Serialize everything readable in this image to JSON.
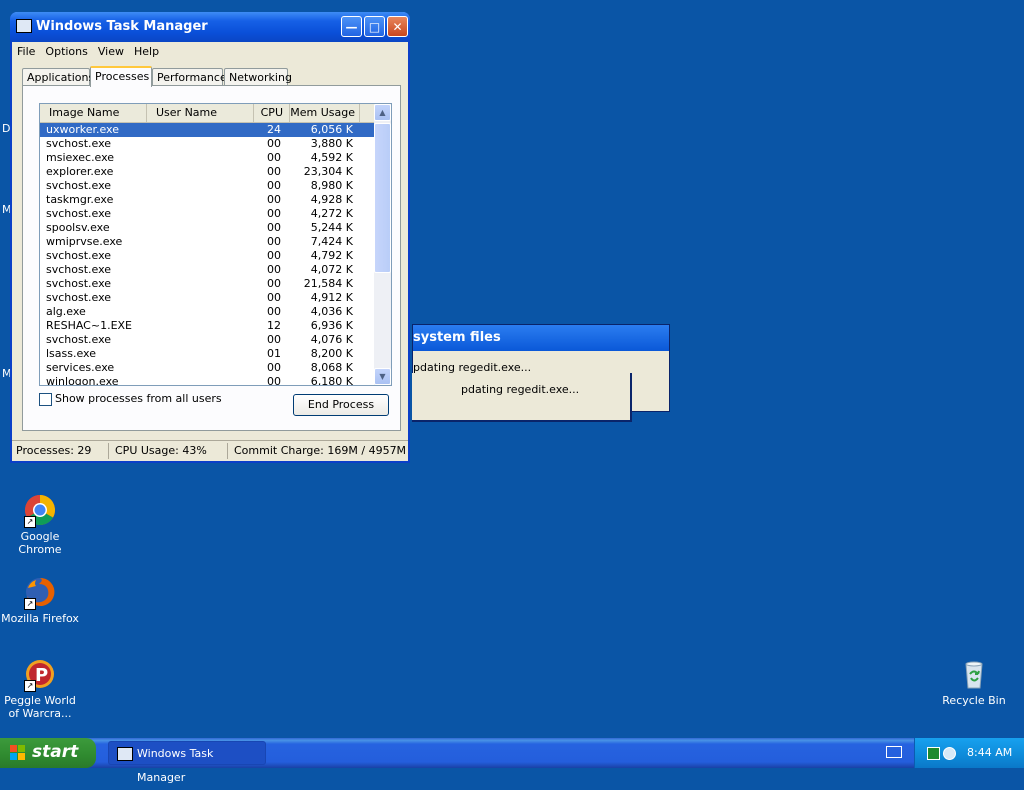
{
  "desktop": {
    "edge_labels": [
      "D",
      "M",
      "M"
    ],
    "icons": [
      {
        "label": "Google Chrome",
        "icon": "chrome-icon"
      },
      {
        "label": "Mozilla Firefox",
        "icon": "firefox-icon"
      },
      {
        "label_line1": "Peggle World",
        "label_line2": "of Warcra...",
        "icon": "peggle-icon"
      },
      {
        "label": "Recycle Bin",
        "icon": "recycle-bin-icon"
      }
    ]
  },
  "background_dialog": {
    "title": "system files",
    "line1": "pdating regedit.exe...",
    "line2": "pdating regedit.exe..."
  },
  "task_manager": {
    "title": "Windows Task Manager",
    "menu": [
      "File",
      "Options",
      "View",
      "Help"
    ],
    "tabs": [
      "Applications",
      "Processes",
      "Performance",
      "Networking"
    ],
    "active_tab": "Processes",
    "columns": [
      "Image Name",
      "User Name",
      "CPU",
      "Mem Usage"
    ],
    "processes": [
      {
        "name": "uxworker.exe",
        "user": "",
        "cpu": "24",
        "mem": "6,056 K",
        "selected": true
      },
      {
        "name": "svchost.exe",
        "user": "",
        "cpu": "00",
        "mem": "3,880 K"
      },
      {
        "name": "msiexec.exe",
        "user": "",
        "cpu": "00",
        "mem": "4,592 K"
      },
      {
        "name": "explorer.exe",
        "user": "",
        "cpu": "00",
        "mem": "23,304 K"
      },
      {
        "name": "svchost.exe",
        "user": "",
        "cpu": "00",
        "mem": "8,980 K"
      },
      {
        "name": "taskmgr.exe",
        "user": "",
        "cpu": "00",
        "mem": "4,928 K"
      },
      {
        "name": "svchost.exe",
        "user": "",
        "cpu": "00",
        "mem": "4,272 K"
      },
      {
        "name": "spoolsv.exe",
        "user": "",
        "cpu": "00",
        "mem": "5,244 K"
      },
      {
        "name": "wmiprvse.exe",
        "user": "",
        "cpu": "00",
        "mem": "7,424 K"
      },
      {
        "name": "svchost.exe",
        "user": "",
        "cpu": "00",
        "mem": "4,792 K"
      },
      {
        "name": "svchost.exe",
        "user": "",
        "cpu": "00",
        "mem": "4,072 K"
      },
      {
        "name": "svchost.exe",
        "user": "",
        "cpu": "00",
        "mem": "21,584 K"
      },
      {
        "name": "svchost.exe",
        "user": "",
        "cpu": "00",
        "mem": "4,912 K"
      },
      {
        "name": "alg.exe",
        "user": "",
        "cpu": "00",
        "mem": "4,036 K"
      },
      {
        "name": "RESHAC~1.EXE",
        "user": "",
        "cpu": "12",
        "mem": "6,936 K"
      },
      {
        "name": "svchost.exe",
        "user": "",
        "cpu": "00",
        "mem": "4,076 K"
      },
      {
        "name": "lsass.exe",
        "user": "",
        "cpu": "01",
        "mem": "8,200 K"
      },
      {
        "name": "services.exe",
        "user": "",
        "cpu": "00",
        "mem": "8,068 K"
      },
      {
        "name": "winlogon.exe",
        "user": "",
        "cpu": "00",
        "mem": "6,180 K"
      }
    ],
    "show_all_users_label": "Show processes from all users",
    "show_all_users_checked": false,
    "end_process_label": "End Process",
    "status": {
      "processes": "Processes: 29",
      "cpu_usage": "CPU Usage: 43%",
      "commit_charge": "Commit Charge: 169M / 4957M"
    }
  },
  "taskbar": {
    "start_label": "start",
    "items": [
      {
        "label": "Windows Task Manager",
        "active": true
      }
    ],
    "clock": "8:44 AM"
  }
}
